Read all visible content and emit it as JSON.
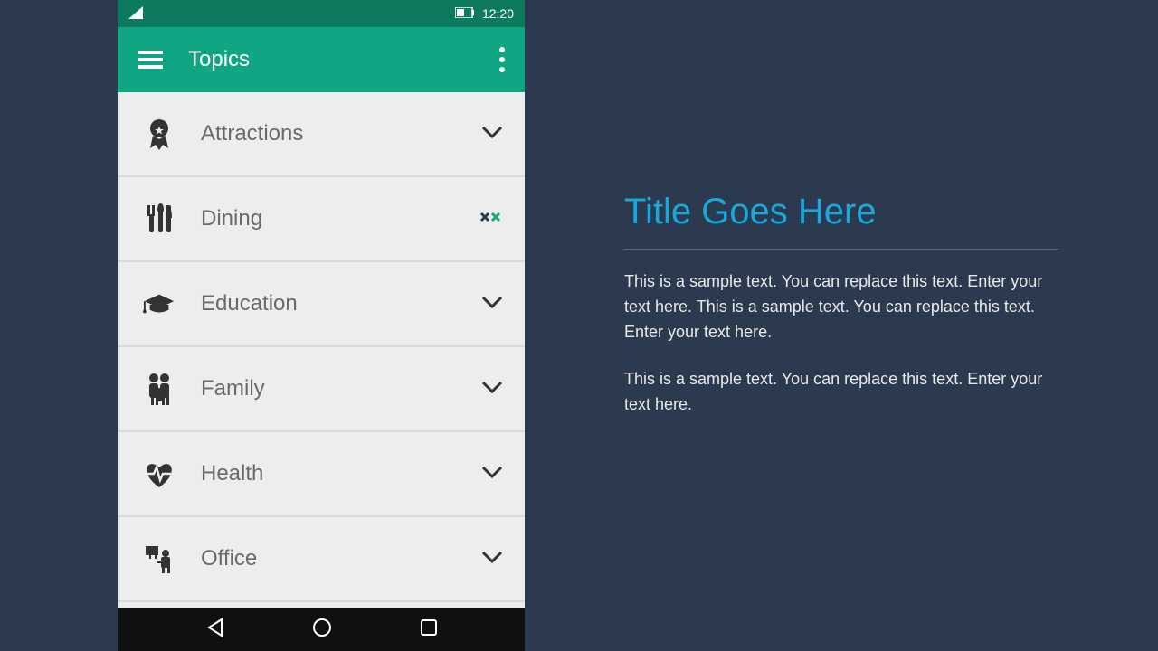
{
  "status": {
    "time": "12:20"
  },
  "appbar": {
    "title": "Topics"
  },
  "items": [
    {
      "label": "Attractions",
      "special": false
    },
    {
      "label": "Dining",
      "special": true
    },
    {
      "label": "Education",
      "special": false
    },
    {
      "label": "Family",
      "special": false
    },
    {
      "label": "Health",
      "special": false
    },
    {
      "label": "Office",
      "special": false
    }
  ],
  "content": {
    "title": "Title Goes Here",
    "p1": "This is a sample text. You can replace this text. Enter your text here. This is a sample text. You can replace this text. Enter your text here.",
    "p2": "This is a sample text. You can replace this text. Enter your text here."
  }
}
